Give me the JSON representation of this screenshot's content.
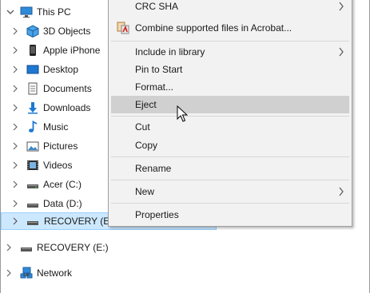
{
  "tree": {
    "this_pc": "This PC",
    "objects_3d": "3D Objects",
    "apple_iphone": "Apple iPhone",
    "desktop": "Desktop",
    "documents": "Documents",
    "downloads": "Downloads",
    "music": "Music",
    "pictures": "Pictures",
    "videos": "Videos",
    "acer": "Acer (C:)",
    "data": "Data (D:)",
    "recovery_selected": "RECOVERY (E:)",
    "recovery_root": "RECOVERY (E:)",
    "network": "Network"
  },
  "menu": {
    "crc_sha": "CRC SHA",
    "combine": "Combine supported files in Acrobat...",
    "include_library": "Include in library",
    "pin_start": "Pin to Start",
    "format": "Format...",
    "eject": "Eject",
    "cut": "Cut",
    "copy": "Copy",
    "rename": "Rename",
    "new": "New",
    "properties": "Properties"
  },
  "icons": {
    "this_pc": "monitor-icon",
    "objects_3d": "cube-icon",
    "apple_iphone": "phone-icon",
    "desktop": "desktop-icon",
    "documents": "document-icon",
    "downloads": "download-arrow-icon",
    "music": "music-note-icon",
    "pictures": "picture-icon",
    "videos": "film-icon",
    "drive": "drive-icon",
    "network": "network-icon",
    "acrobat": "acrobat-icon"
  },
  "colors": {
    "selection_bg": "#cce8ff",
    "selection_border": "#99d1ff",
    "menu_bg": "#f2f2f2",
    "menu_highlight": "#d0d0d0",
    "accent_blue": "#1e78d2"
  }
}
